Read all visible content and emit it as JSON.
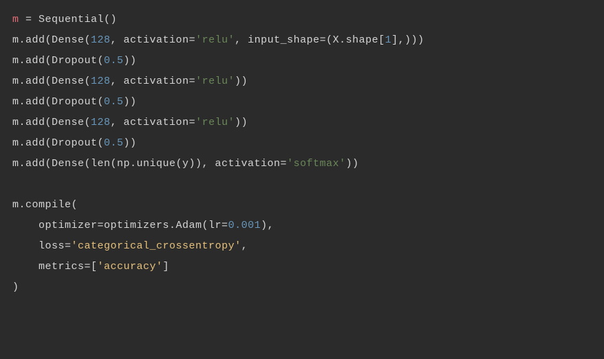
{
  "lines": {
    "l1_var": "m",
    "l1_eq": " = ",
    "l1_fn": "Sequential()",
    "l2_pre": "m.add(Dense(",
    "l2_num": "128",
    "l2_mid": ", activation=",
    "l2_str": "'relu'",
    "l2_mid2": ", input_shape=(X.shape[",
    "l2_idx": "1",
    "l2_end": "],)))",
    "l3_pre": "m.add(Dropout(",
    "l3_num": "0.5",
    "l3_end": "))",
    "l4_pre": "m.add(Dense(",
    "l4_num": "128",
    "l4_mid": ", activation=",
    "l4_str": "'relu'",
    "l4_end": "))",
    "l5_pre": "m.add(Dropout(",
    "l5_num": "0.5",
    "l5_end": "))",
    "l6_pre": "m.add(Dense(",
    "l6_num": "128",
    "l6_mid": ", activation=",
    "l6_str": "'relu'",
    "l6_end": "))",
    "l7_pre": "m.add(Dropout(",
    "l7_num": "0.5",
    "l7_end": "))",
    "l8_pre": "m.add(Dense(len(np.unique(y)), activation=",
    "l8_str": "'softmax'",
    "l8_end": "))",
    "l10_pre": "m.compile(",
    "l11_indent": "    ",
    "l11_pre": "optimizer=optimizers.Adam(lr=",
    "l11_num": "0.001",
    "l11_end": "),",
    "l12_indent": "    ",
    "l12_pre": "loss=",
    "l12_str": "'categorical_crossentropy'",
    "l12_end": ",",
    "l13_indent": "    ",
    "l13_pre": "metrics=[",
    "l13_str": "'accuracy'",
    "l13_end": "]",
    "l14": ")"
  }
}
